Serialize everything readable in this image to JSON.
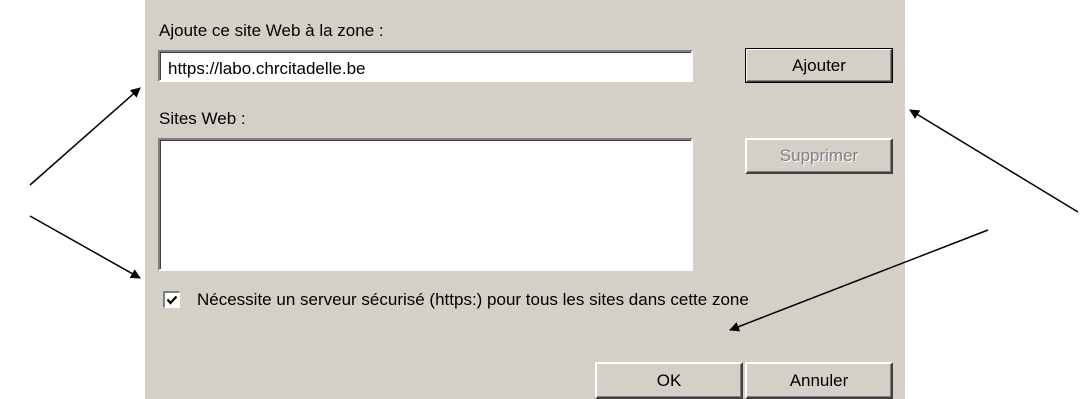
{
  "dialog": {
    "add_label": "Ajoute ce site Web à la zone :",
    "url_value": "https://labo.chrcitadelle.be",
    "add_button": "Ajouter",
    "sites_label": "Sites Web :",
    "remove_button": "Supprimer",
    "secure_checkbox_label": "Nécessite un serveur sécurisé (https:) pour tous les sites dans cette zone",
    "secure_checked": true,
    "ok_button": "OK",
    "cancel_button": "Annuler"
  },
  "colors": {
    "dialog_bg": "#d4d0c8",
    "disabled_text": "#808080"
  }
}
